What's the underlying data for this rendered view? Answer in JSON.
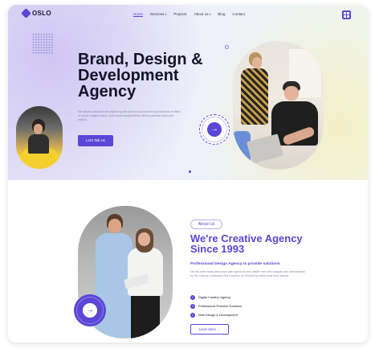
{
  "brand": {
    "name": "OSLO",
    "accent": "#5b46d6"
  },
  "nav": {
    "items": [
      {
        "label": "Home",
        "active": true
      },
      {
        "label": "Services",
        "caret": "▾"
      },
      {
        "label": "Projects"
      },
      {
        "label": "About us",
        "caret": "▾"
      },
      {
        "label": "Blog"
      },
      {
        "label": "Contact"
      }
    ],
    "menu_icon": "grid-icon"
  },
  "hero": {
    "title": "Brand, Design & Development Agency",
    "text": "We assist connoisseurs adipiscing elit sed do eiusmod kem pulvinaribus et tellus et dolore magna aliqua. Quis ipsum suspendisse ultrices gravida commodo viverra",
    "cta": "Let's Talk Us",
    "badge_icon": "arrow-right-icon"
  },
  "about": {
    "pill": "About Us",
    "title": "We're Creative Agency Since 1993",
    "subtitle": "Professional Design Agency to provide solutions",
    "text": "On the other hand denounce with righteous and dislike men who beguile and demoralized by the charms of pleasure the moment, so blinded by desire that they cannot",
    "checks": [
      "Digital Creative Agency",
      "Professional Problem Solutions",
      "Web Design & Development"
    ],
    "button": "Learn More →",
    "badge_icon": "arrow-right-icon"
  }
}
